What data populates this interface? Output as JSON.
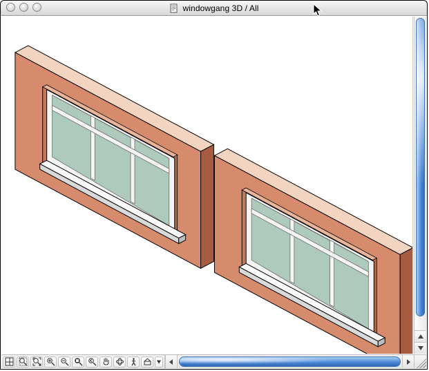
{
  "window": {
    "title": "windowgang 3D / All"
  },
  "colors": {
    "wall_face": "#d58b6c",
    "wall_side_dark": "#a65c40",
    "wall_top_light": "#e8b59a",
    "wall_top_highlight": "#f3d4c0",
    "glass": "#aecabc",
    "frame": "#f4f4f4",
    "frame_edge": "#6b6b6b",
    "sill_top": "#fafafa",
    "sill_front": "#d9d9d9",
    "outline": "#000000",
    "background": "#ffffff"
  },
  "toolbar": {
    "buttons": [
      "keyplan-icon",
      "zoom-window-icon",
      "zoom-selection-icon",
      "zoom-in-icon",
      "zoom-out-icon",
      "zoom-fit-icon",
      "zoom-prev-icon",
      "pan-icon",
      "orbit-icon",
      "walk-icon",
      "explore-icon"
    ]
  }
}
